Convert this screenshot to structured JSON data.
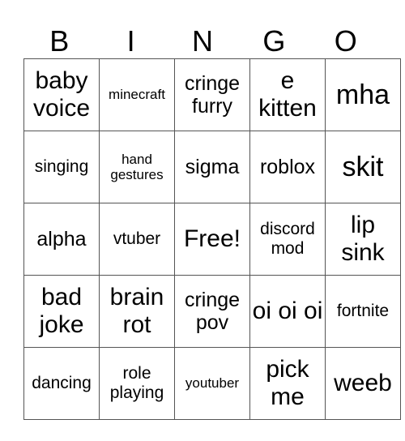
{
  "header": {
    "letters": [
      "B",
      "I",
      "N",
      "G",
      "O"
    ]
  },
  "card": {
    "rows": [
      [
        {
          "text": "baby voice",
          "size": "l"
        },
        {
          "text": "minecraft",
          "size": "xs"
        },
        {
          "text": "cringe furry",
          "size": "m"
        },
        {
          "text": "e kitten",
          "size": "l"
        },
        {
          "text": "mha",
          "size": "xl"
        }
      ],
      [
        {
          "text": "singing",
          "size": "s"
        },
        {
          "text": "hand gestures",
          "size": "xs"
        },
        {
          "text": "sigma",
          "size": "m"
        },
        {
          "text": "roblox",
          "size": "m"
        },
        {
          "text": "skit",
          "size": "xl"
        }
      ],
      [
        {
          "text": "alpha",
          "size": "m"
        },
        {
          "text": "vtuber",
          "size": "s"
        },
        {
          "text": "Free!",
          "size": "l"
        },
        {
          "text": "discord mod",
          "size": "s"
        },
        {
          "text": "lip sink",
          "size": "l"
        }
      ],
      [
        {
          "text": "bad joke",
          "size": "l"
        },
        {
          "text": "brain rot",
          "size": "l"
        },
        {
          "text": "cringe pov",
          "size": "m"
        },
        {
          "text": "oi oi oi",
          "size": "l"
        },
        {
          "text": "fortnite",
          "size": "s"
        }
      ],
      [
        {
          "text": "dancing",
          "size": "s"
        },
        {
          "text": "role playing",
          "size": "s"
        },
        {
          "text": "youtuber",
          "size": "xs"
        },
        {
          "text": "pick me",
          "size": "l"
        },
        {
          "text": "weeb",
          "size": "l"
        }
      ]
    ]
  }
}
